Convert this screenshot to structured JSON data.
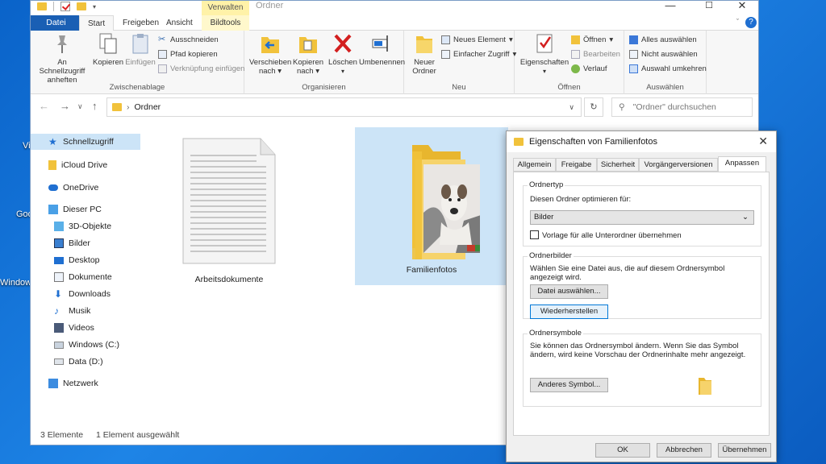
{
  "desktop": {
    "labels": [
      "Vi",
      "Goo",
      "Window"
    ]
  },
  "explorer": {
    "title": "Ordner",
    "contextual_group": "Verwalten",
    "tabs": {
      "file": "Datei",
      "start": "Start",
      "share": "Freigeben",
      "view": "Ansicht",
      "picture_tools": "Bildtools"
    },
    "ribbon": {
      "clipboard": {
        "pin": "An Schnellzugriff anheften",
        "copy": "Kopieren",
        "paste": "Einfügen",
        "cut": "Ausschneiden",
        "copy_path": "Pfad kopieren",
        "paste_shortcut": "Verknüpfung einfügen",
        "label": "Zwischenablage"
      },
      "organize": {
        "move_to": "Verschieben nach",
        "copy_to": "Kopieren nach",
        "delete": "Löschen",
        "rename": "Umbenennen",
        "label": "Organisieren"
      },
      "new": {
        "new_folder": "Neuer Ordner",
        "new_item": "Neues Element",
        "easy_access": "Einfacher Zugriff",
        "label": "Neu"
      },
      "open": {
        "properties": "Eigenschaften",
        "open": "Öffnen",
        "edit": "Bearbeiten",
        "history": "Verlauf",
        "label": "Öffnen"
      },
      "select": {
        "select_all": "Alles auswählen",
        "select_none": "Nicht auswählen",
        "invert": "Auswahl umkehren",
        "label": "Auswählen"
      }
    },
    "address": {
      "path": "Ordner",
      "search_placeholder": "\"Ordner\" durchsuchen"
    },
    "nav": [
      "Schnellzugriff",
      "iCloud Drive",
      "OneDrive",
      "Dieser PC",
      "3D-Objekte",
      "Bilder",
      "Desktop",
      "Dokumente",
      "Downloads",
      "Musik",
      "Videos",
      "Windows (C:)",
      "Data (D:)",
      "Netzwerk"
    ],
    "files": {
      "doc": "Arbeitsdokumente",
      "folder": "Familienfotos"
    },
    "status": {
      "count": "3 Elemente",
      "selected": "1 Element ausgewählt"
    }
  },
  "dialog": {
    "title": "Eigenschaften von Familienfotos",
    "tabs": [
      "Allgemein",
      "Freigabe",
      "Sicherheit",
      "Vorgängerversionen",
      "Anpassen"
    ],
    "folder_type": {
      "legend": "Ordnertyp",
      "optimize_label": "Diesen Ordner optimieren für:",
      "selected": "Bilder",
      "apply_subfolders": "Vorlage für alle Unterordner übernehmen",
      "apply_checked": false
    },
    "folder_pictures": {
      "legend": "Ordnerbilder",
      "desc": "Wählen Sie eine Datei aus, die auf diesem Ordnersymbol angezeigt wird.",
      "choose_file": "Datei auswählen...",
      "restore": "Wiederherstellen"
    },
    "folder_icons": {
      "legend": "Ordnersymbole",
      "desc": "Sie können das Ordnersymbol ändern. Wenn Sie das Symbol ändern, wird keine Vorschau der Ordnerinhalte mehr angezeigt.",
      "change_icon": "Anderes Symbol..."
    },
    "buttons": {
      "ok": "OK",
      "cancel": "Abbrechen",
      "apply": "Übernehmen"
    }
  },
  "colors": {
    "accent": "#1a5fb4",
    "folder_yellow": "#f1c23b",
    "selection": "#cce4f7",
    "desktop": "#1e84e6"
  }
}
